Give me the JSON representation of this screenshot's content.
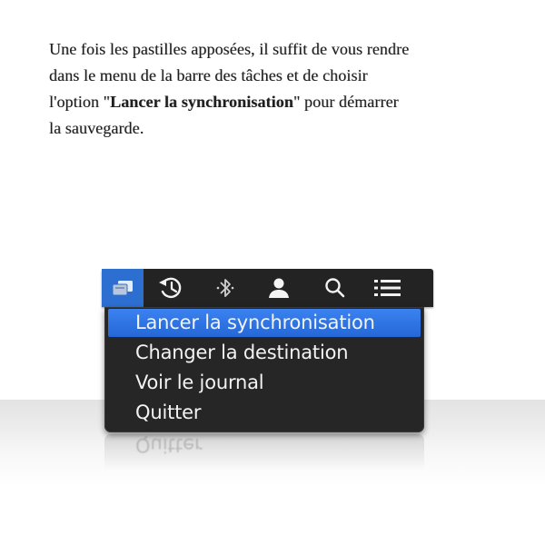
{
  "instructions": {
    "line1": "Une fois les pastilles apposées, il suffit de vous rendre",
    "line2": "dans le menu de la barre des tâches et de choisir",
    "line3_pre": "l'option \"",
    "line3_bold": "Lancer la synchronisation",
    "line3_post": "\" pour démarrer",
    "line4": "la sauvegarde."
  },
  "menubar": {
    "icons": [
      "app-icon",
      "history-icon",
      "bluetooth-icon",
      "user-icon",
      "search-icon",
      "list-icon"
    ],
    "active_color": "#2d6fd0"
  },
  "menu": {
    "items": [
      {
        "label": "Lancer la synchronisation",
        "highlighted": true
      },
      {
        "label": "Changer la destination"
      },
      {
        "label": "Voir le journal"
      },
      {
        "label": "Quitter"
      }
    ],
    "highlight_color": "#2f74e3"
  },
  "reflection": {
    "label": "Quitter"
  }
}
